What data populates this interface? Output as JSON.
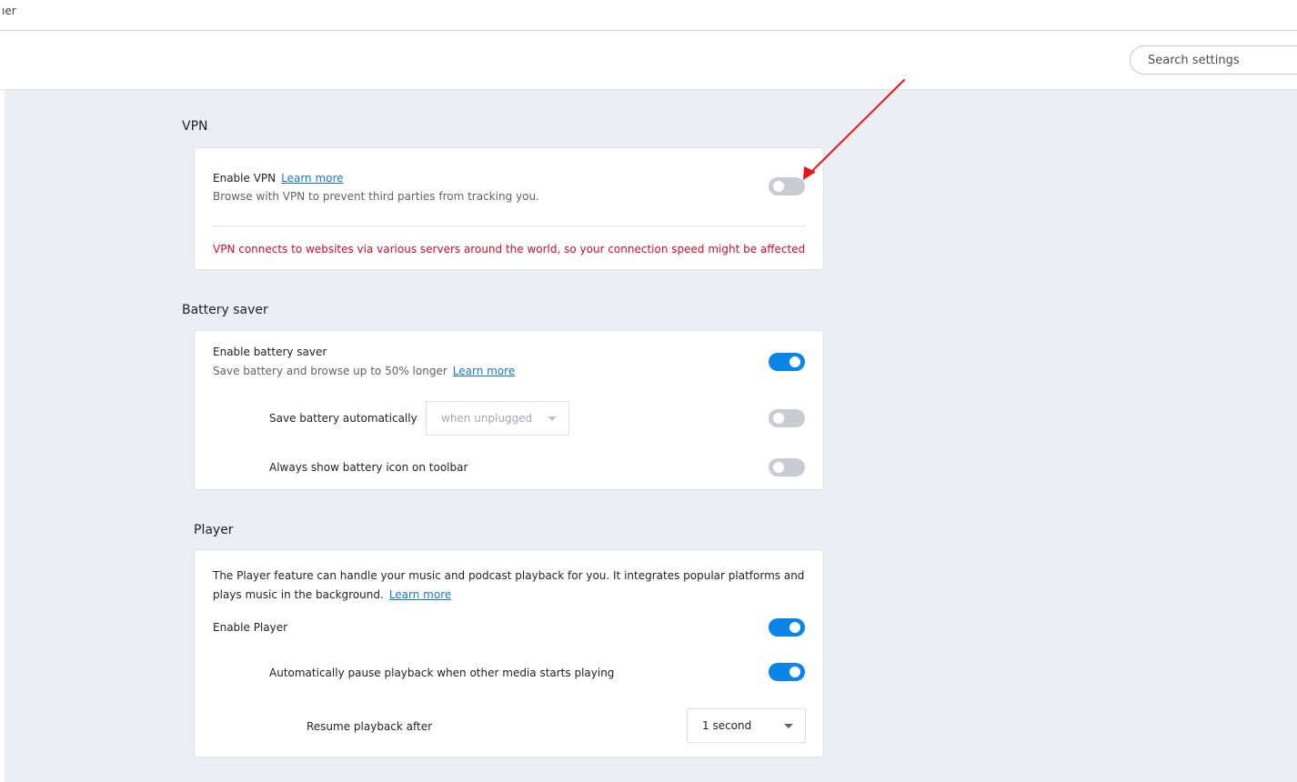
{
  "top_fragment": "ıer",
  "search": {
    "placeholder": "Search settings"
  },
  "vpn": {
    "title": "VPN",
    "enable_label": "Enable VPN",
    "learn_more": "Learn more",
    "description": "Browse with VPN to prevent third parties from tracking you.",
    "enabled": false,
    "warning": "VPN connects to websites via various servers around the world, so your connection speed might be affected"
  },
  "battery": {
    "title": "Battery saver",
    "enable_label": "Enable battery saver",
    "description": "Save battery and browse up to 50% longer",
    "learn_more": "Learn more",
    "enabled": true,
    "auto_label": "Save battery automatically",
    "auto_select": "when unplugged",
    "auto_enabled": false,
    "icon_label": "Always show battery icon on toolbar",
    "icon_enabled": false
  },
  "player": {
    "title": "Player",
    "description": "The Player feature can handle your music and podcast playback for you. It integrates popular platforms and plays music in the background.",
    "learn_more": "Learn more",
    "enable_label": "Enable Player",
    "enabled": true,
    "pause_label": "Automatically pause playback when other media starts playing",
    "pause_enabled": true,
    "resume_label": "Resume playback after",
    "resume_select": "1 second"
  },
  "colors": {
    "accent": "#0a84e6",
    "warning": "#c5112a",
    "annotation_arrow": "#e8141c"
  }
}
